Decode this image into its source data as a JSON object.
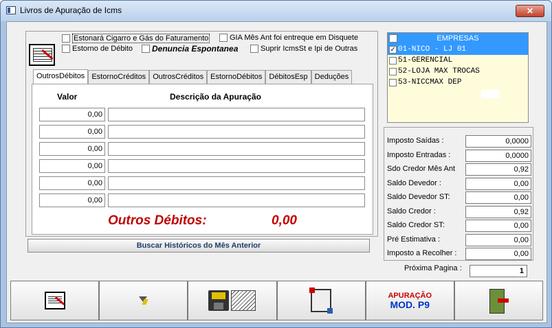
{
  "window": {
    "title": "Livros de Apuração de Icms",
    "close_label": "✕"
  },
  "options": {
    "estornar_cigarro": {
      "label": "Estonará Cigarro e Gás do Faturamento",
      "checked": false
    },
    "gia_mes_ant": {
      "label": "GIA Mês Ant foi entreque em Disquete",
      "checked": false
    },
    "estorno_debito": {
      "label": "Estorno de Débito",
      "checked": false
    },
    "denuncia": {
      "label": "Denuncia Espontanea",
      "checked": false
    },
    "suprir": {
      "label": "Suprir IcmsSt e Ipi de Outras",
      "checked": false
    }
  },
  "tabs": [
    {
      "label": "OutrosDébitos",
      "active": true
    },
    {
      "label": "EstornoCréditos",
      "active": false
    },
    {
      "label": "OutrosCréditos",
      "active": false
    },
    {
      "label": "EstornoDébitos",
      "active": false
    },
    {
      "label": "DébitosEsp",
      "active": false
    },
    {
      "label": "Deduções",
      "active": false
    }
  ],
  "grid": {
    "col_valor": "Valor",
    "col_descricao": "Descrição da Apuração",
    "rows": [
      {
        "valor": "0,00",
        "descricao": ""
      },
      {
        "valor": "0,00",
        "descricao": ""
      },
      {
        "valor": "0,00",
        "descricao": ""
      },
      {
        "valor": "0,00",
        "descricao": ""
      },
      {
        "valor": "0,00",
        "descricao": ""
      },
      {
        "valor": "0,00",
        "descricao": ""
      }
    ],
    "total_label": "Outros Débitos:",
    "total_value": "0,00"
  },
  "buscar_button": "Buscar Históricos do Mês Anterior",
  "empresas": {
    "header": "EMPRESAS",
    "items": [
      {
        "label": "01-NICO     - LJ 01",
        "checked": true,
        "selected": true
      },
      {
        "label": "51-GERENCIAL",
        "checked": false,
        "selected": false
      },
      {
        "label": "52-LOJA MAX TROCAS",
        "checked": false,
        "selected": false
      },
      {
        "label": "53-NICCMAX DEP",
        "checked": false,
        "selected": false
      }
    ]
  },
  "summary": [
    {
      "label": "Imposto Saídas :",
      "value": "0,0000"
    },
    {
      "label": "Imposto Entradas :",
      "value": "0,0000"
    },
    {
      "label": "Sdo Credor Mês Ant",
      "value": "0,92"
    },
    {
      "label": "Saldo Devedor :",
      "value": "0,00"
    },
    {
      "label": "Saldo Devedor ST:",
      "value": "0,00"
    },
    {
      "label": "Saldo Credor :",
      "value": "0,92"
    },
    {
      "label": "Saldo Credor ST:",
      "value": "0,00"
    },
    {
      "label": "Pré Estimativa :",
      "value": "0,00"
    },
    {
      "label": "Imposto a Recolher :",
      "value": "0,00"
    }
  ],
  "next_page": {
    "label": "Próxima Pagina :",
    "value": "1"
  },
  "toolbar": {
    "apuracao_line1": "APURAÇÃO",
    "apuracao_line2": "MOD. P9",
    "icons": [
      "report-icon",
      "filter-icon",
      "save-icon",
      "spreadsheet-icon",
      "crop-icon",
      "apuracao-mod-p9-icon",
      "exit-icon"
    ]
  }
}
